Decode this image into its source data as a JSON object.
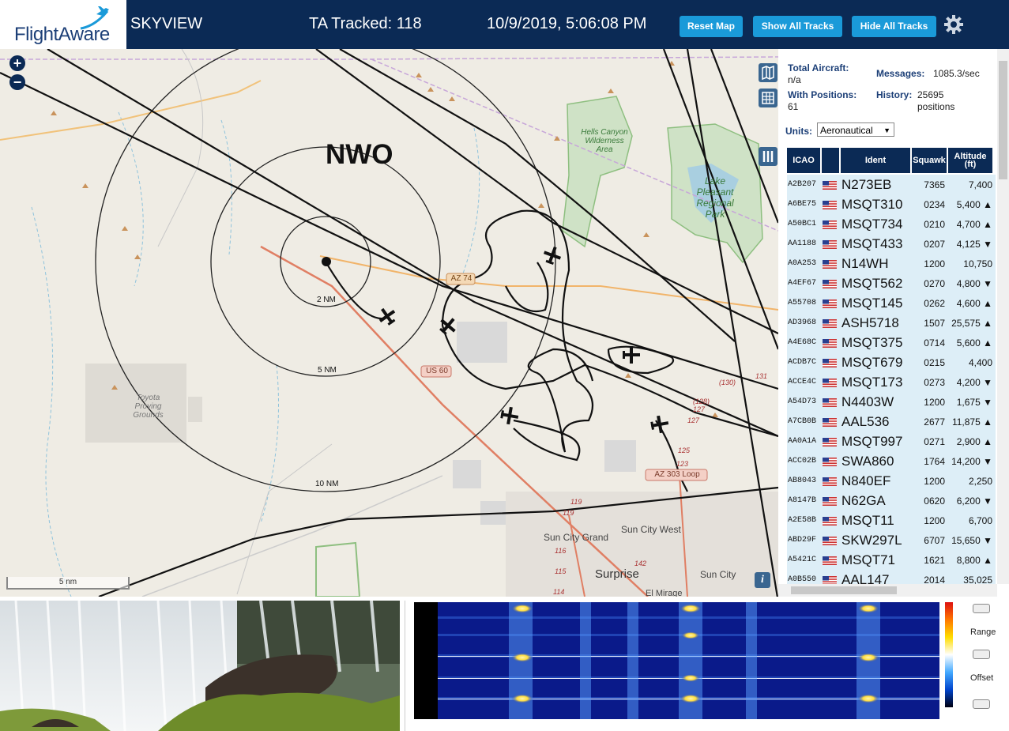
{
  "header": {
    "logo_text": "FlightAware",
    "app_name": "SKYVIEW",
    "ta_tracked": "TA Tracked: 118",
    "datetime": "10/9/2019, 5:06:08 PM",
    "buttons": {
      "reset_map": "Reset Map",
      "show_all_tracks": "Show All Tracks",
      "hide_all_tracks": "Hide All Tracks"
    }
  },
  "map": {
    "zoom_in": "+",
    "zoom_out": "−",
    "station_label": "NWO",
    "range_labels": [
      "2 NM",
      "5 NM",
      "10 NM"
    ],
    "place_labels": [
      "Hells Canyon Wilderness Area",
      "Lake Pleasant Regional Park",
      "Toyota Proving Grounds",
      "Sun City Grand",
      "Sun City West",
      "Surprise",
      "Sun City",
      "El Mirage"
    ],
    "road_labels": [
      "AZ 74",
      "US 60",
      "AZ 303 Loop"
    ],
    "route_numbers": [
      "(130)",
      "131",
      "(128)",
      "127",
      "127",
      "125",
      "123",
      "119",
      "119",
      "116",
      "115",
      "114",
      "142"
    ],
    "scale_label": "5 nm",
    "info_button": "i"
  },
  "panel": {
    "total_aircraft_label": "Total Aircraft:",
    "total_aircraft_value": "n/a",
    "messages_label": "Messages:",
    "messages_value": "1085.3/sec",
    "with_positions_label": "With Positions:",
    "with_positions_value": "61",
    "history_label": "History:",
    "history_value": "25695 positions",
    "units_label": "Units:",
    "units_value": "Aeronautical",
    "columns": [
      "ICAO",
      "",
      "Ident",
      "Squawk",
      "Altitude (ft)"
    ],
    "rows": [
      {
        "icao": "A2B207",
        "ident": "N273EB",
        "squawk": "7365",
        "alt": "7,400"
      },
      {
        "icao": "A6BE75",
        "ident": "MSQT310",
        "squawk": "0234",
        "alt": "5,400 ▲"
      },
      {
        "icao": "A50BC1",
        "ident": "MSQT734",
        "squawk": "0210",
        "alt": "4,700 ▲"
      },
      {
        "icao": "AA1188",
        "ident": "MSQT433",
        "squawk": "0207",
        "alt": "4,125 ▼"
      },
      {
        "icao": "A0A253",
        "ident": "N14WH",
        "squawk": "1200",
        "alt": "10,750"
      },
      {
        "icao": "A4EF67",
        "ident": "MSQT562",
        "squawk": "0270",
        "alt": "4,800 ▼"
      },
      {
        "icao": "A55708",
        "ident": "MSQT145",
        "squawk": "0262",
        "alt": "4,600 ▲"
      },
      {
        "icao": "AD3968",
        "ident": "ASH5718",
        "squawk": "1507",
        "alt": "25,575 ▲"
      },
      {
        "icao": "A4E68C",
        "ident": "MSQT375",
        "squawk": "0714",
        "alt": "5,600 ▲"
      },
      {
        "icao": "ACDB7C",
        "ident": "MSQT679",
        "squawk": "0215",
        "alt": "4,400"
      },
      {
        "icao": "ACCE4C",
        "ident": "MSQT173",
        "squawk": "0273",
        "alt": "4,200 ▼"
      },
      {
        "icao": "A54D73",
        "ident": "N4403W",
        "squawk": "1200",
        "alt": "1,675 ▼"
      },
      {
        "icao": "A7CB0B",
        "ident": "AAL536",
        "squawk": "2677",
        "alt": "11,875 ▲"
      },
      {
        "icao": "AA0A1A",
        "ident": "MSQT997",
        "squawk": "0271",
        "alt": "2,900 ▲"
      },
      {
        "icao": "ACC02B",
        "ident": "SWA860",
        "squawk": "1764",
        "alt": "14,200 ▼"
      },
      {
        "icao": "AB8043",
        "ident": "N840EF",
        "squawk": "1200",
        "alt": "2,250"
      },
      {
        "icao": "A8147B",
        "ident": "N62GA",
        "squawk": "0620",
        "alt": "6,200 ▼"
      },
      {
        "icao": "A2E58B",
        "ident": "MSQT11",
        "squawk": "1200",
        "alt": "6,700"
      },
      {
        "icao": "ABD29F",
        "ident": "SKW297L",
        "squawk": "6707",
        "alt": "15,650 ▼"
      },
      {
        "icao": "A5421C",
        "ident": "MSQT71",
        "squawk": "1621",
        "alt": "8,800 ▲"
      },
      {
        "icao": "A0B550",
        "ident": "AAL147",
        "squawk": "2014",
        "alt": "35,025"
      }
    ]
  },
  "spectrogram": {
    "range_label": "Range",
    "offset_label": "Offset"
  },
  "colors": {
    "header_bg": "#0b2a55",
    "button_bg": "#1a9ad9",
    "row_bg": "#ddeef7",
    "map_bg": "#efece4"
  }
}
